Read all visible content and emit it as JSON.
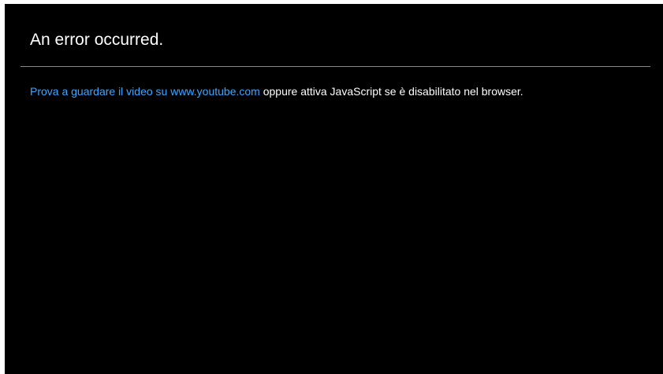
{
  "error": {
    "title": "An error occurred.",
    "link_text": "Prova a guardare il video su www.youtube.com",
    "message_rest": " oppure attiva JavaScript se è disabilitato nel browser."
  },
  "colors": {
    "background": "#000000",
    "text": "#ffffff",
    "link": "#3ea6ff",
    "divider": "#8a8a8a"
  }
}
